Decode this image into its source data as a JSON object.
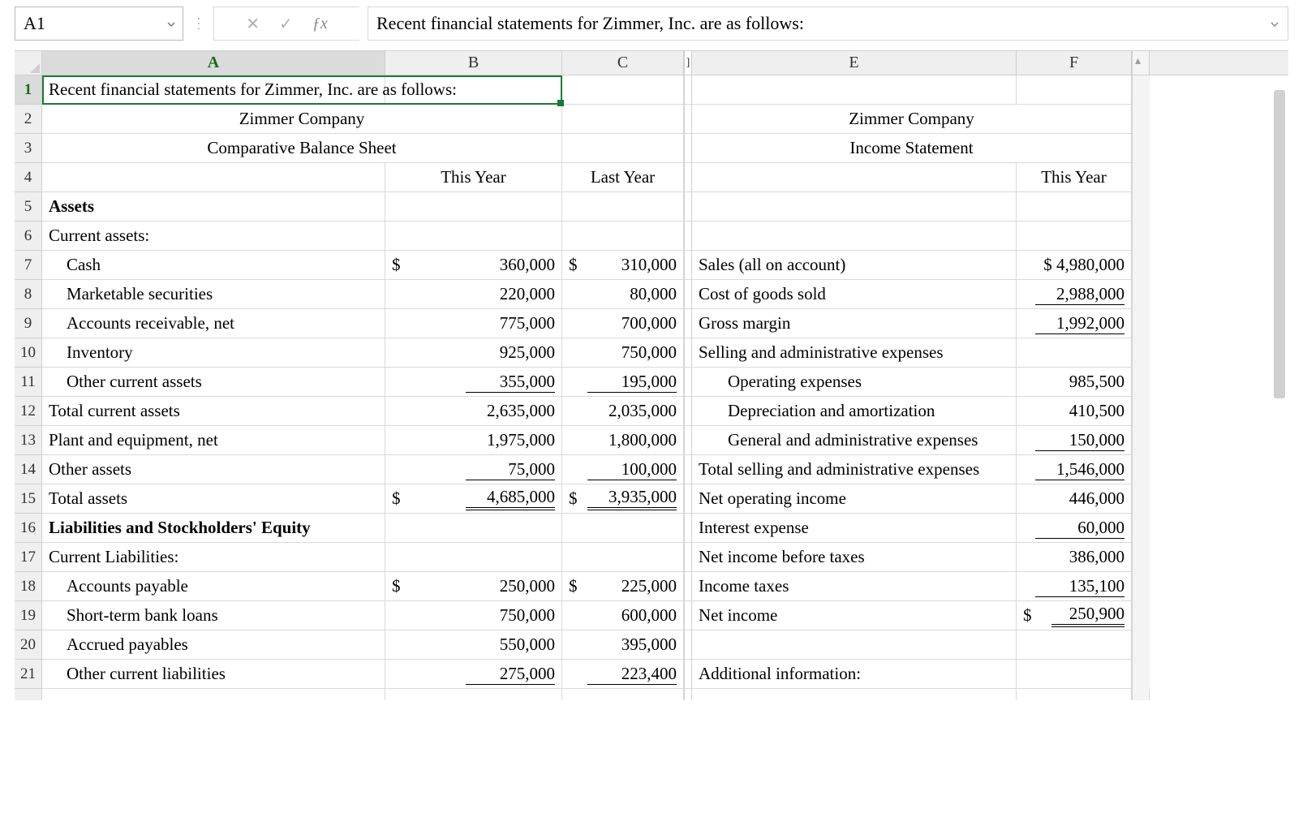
{
  "namebox": "A1",
  "formula_bar": "Recent financial statements for Zimmer, Inc. are as follows:",
  "col_headers": [
    "A",
    "B",
    "C",
    "E",
    "F"
  ],
  "row_headers": [
    "1",
    "2",
    "3",
    "4",
    "5",
    "6",
    "7",
    "8",
    "9",
    "10",
    "11",
    "12",
    "13",
    "14",
    "15",
    "16",
    "17",
    "18",
    "19",
    "20",
    "21"
  ],
  "rows": {
    "1": {
      "A": "Recent financial statements for Zimmer, Inc. are as follows:"
    },
    "2": {
      "AB": "Zimmer Company",
      "EF": "Zimmer Company"
    },
    "3": {
      "AB": "Comparative Balance Sheet",
      "EF": "Income Statement"
    },
    "4": {
      "B": "This Year",
      "C": "Last Year",
      "F": "This Year"
    },
    "5": {
      "A": "Assets"
    },
    "6": {
      "A": "Current assets:"
    },
    "7": {
      "A": "Cash",
      "B": "360,000",
      "C": "310,000",
      "E": "Sales (all on account)",
      "F": "$ 4,980,000",
      "Bs": "$",
      "Cs": "$"
    },
    "8": {
      "A": "Marketable securities",
      "B": "220,000",
      "C": "80,000",
      "E": "Cost of goods sold",
      "F": "2,988,000"
    },
    "9": {
      "A": "Accounts receivable, net",
      "B": "775,000",
      "C": "700,000",
      "E": "Gross margin",
      "F": "1,992,000"
    },
    "10": {
      "A": "Inventory",
      "B": "925,000",
      "C": "750,000",
      "E": "Selling and administrative expenses"
    },
    "11": {
      "A": "Other current assets",
      "B": "355,000",
      "C": "195,000",
      "E": "Operating expenses",
      "F": "985,500"
    },
    "12": {
      "A": "Total current assets",
      "B": "2,635,000",
      "C": "2,035,000",
      "E": "Depreciation and amortization",
      "F": "410,500"
    },
    "13": {
      "A": "Plant and equipment, net",
      "B": "1,975,000",
      "C": "1,800,000",
      "E": "General and administrative expenses",
      "F": "150,000"
    },
    "14": {
      "A": "Other assets",
      "B": "75,000",
      "C": "100,000",
      "E": "Total selling and administrative expenses",
      "F": "1,546,000"
    },
    "15": {
      "A": "Total assets",
      "B": "4,685,000",
      "C": "3,935,000",
      "E": "Net operating income",
      "F": "446,000",
      "Bs": "$",
      "Cs": "$"
    },
    "16": {
      "A": "Liabilities and Stockholders' Equity",
      "E": "Interest expense",
      "F": "60,000"
    },
    "17": {
      "A": "Current Liabilities:",
      "E": "Net income before taxes",
      "F": "386,000"
    },
    "18": {
      "A": "Accounts payable",
      "B": "250,000",
      "C": "225,000",
      "E": "Income taxes",
      "F": "135,100",
      "Bs": "$",
      "Cs": "$"
    },
    "19": {
      "A": "Short-term bank loans",
      "B": "750,000",
      "C": "600,000",
      "E": "Net income",
      "F": "250,900",
      "Fs": "$"
    },
    "20": {
      "A": "Accrued payables",
      "B": "550,000",
      "C": "395,000"
    },
    "21": {
      "A": "Other current liabilities",
      "B": "275,000",
      "C": "223,400",
      "E": "Additional information:"
    }
  },
  "chart_data": {
    "type": "table",
    "balance_sheet": {
      "title": "Zimmer Company — Comparative Balance Sheet",
      "columns": [
        "This Year",
        "Last Year"
      ],
      "rows": [
        {
          "label": "Cash",
          "values": [
            360000,
            310000
          ]
        },
        {
          "label": "Marketable securities",
          "values": [
            220000,
            80000
          ]
        },
        {
          "label": "Accounts receivable, net",
          "values": [
            775000,
            700000
          ]
        },
        {
          "label": "Inventory",
          "values": [
            925000,
            750000
          ]
        },
        {
          "label": "Other current assets",
          "values": [
            355000,
            195000
          ]
        },
        {
          "label": "Total current assets",
          "values": [
            2635000,
            2035000
          ]
        },
        {
          "label": "Plant and equipment, net",
          "values": [
            1975000,
            1800000
          ]
        },
        {
          "label": "Other assets",
          "values": [
            75000,
            100000
          ]
        },
        {
          "label": "Total assets",
          "values": [
            4685000,
            3935000
          ]
        },
        {
          "label": "Accounts payable",
          "values": [
            250000,
            225000
          ]
        },
        {
          "label": "Short-term bank loans",
          "values": [
            750000,
            600000
          ]
        },
        {
          "label": "Accrued payables",
          "values": [
            550000,
            395000
          ]
        },
        {
          "label": "Other current liabilities",
          "values": [
            275000,
            223400
          ]
        }
      ]
    },
    "income_statement": {
      "title": "Zimmer Company — Income Statement",
      "columns": [
        "This Year"
      ],
      "rows": [
        {
          "label": "Sales (all on account)",
          "values": [
            4980000
          ]
        },
        {
          "label": "Cost of goods sold",
          "values": [
            2988000
          ]
        },
        {
          "label": "Gross margin",
          "values": [
            1992000
          ]
        },
        {
          "label": "Operating expenses",
          "values": [
            985500
          ]
        },
        {
          "label": "Depreciation and amortization",
          "values": [
            410500
          ]
        },
        {
          "label": "General and administrative expenses",
          "values": [
            150000
          ]
        },
        {
          "label": "Total selling and administrative expenses",
          "values": [
            1546000
          ]
        },
        {
          "label": "Net operating income",
          "values": [
            446000
          ]
        },
        {
          "label": "Interest expense",
          "values": [
            60000
          ]
        },
        {
          "label": "Net income before taxes",
          "values": [
            386000
          ]
        },
        {
          "label": "Income taxes",
          "values": [
            135100
          ]
        },
        {
          "label": "Net income",
          "values": [
            250900
          ]
        }
      ]
    }
  }
}
